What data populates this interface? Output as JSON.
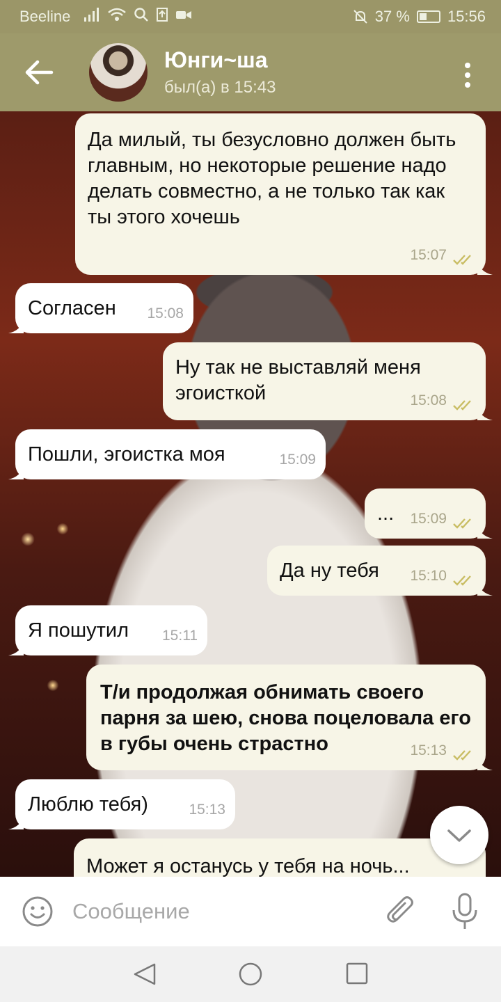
{
  "status_bar": {
    "carrier": "Beeline",
    "battery": "37 %",
    "battery_level": 0.37,
    "time": "15:56"
  },
  "header": {
    "title": "Юнги~ша",
    "status": "был(а) в 15:43"
  },
  "messages": [
    {
      "dir": "out",
      "text": "Да милый, ты безусловно должен быть главным, но некоторые решение надо делать совместно, а не только так как ты этого хочешь",
      "time": "15:07",
      "read": true
    },
    {
      "dir": "in",
      "text": "Согласен",
      "time": "15:08"
    },
    {
      "dir": "out",
      "text": "Ну так не выставляй меня эгоисткой",
      "time": "15:08",
      "read": true
    },
    {
      "dir": "in",
      "text": "Пошли, эгоистка моя",
      "time": "15:09"
    },
    {
      "dir": "out",
      "text": "...",
      "time": "15:09",
      "read": true
    },
    {
      "dir": "out",
      "text": "Да ну тебя",
      "time": "15:10",
      "read": true
    },
    {
      "dir": "in",
      "text": "Я пошутил",
      "time": "15:11"
    },
    {
      "dir": "out",
      "text": "Т/и продолжая обнимать своего парня за шею, снова поцеловала его в губы очень страстно",
      "time": "15:13",
      "read": true,
      "bold": true
    },
    {
      "dir": "in",
      "text": "Люблю тебя)",
      "time": "15:13"
    },
    {
      "dir": "out",
      "text": "Может я останусь у тебя на ночь...",
      "time": ""
    }
  ],
  "input": {
    "placeholder": "Сообщение"
  },
  "colors": {
    "header": "#9e9a6b",
    "outgoing_bubble": "#f7f5e7",
    "incoming_bubble": "#ffffff",
    "read_ticks": "#c9bd63"
  },
  "icons": [
    "back-arrow-icon",
    "more-vert-icon",
    "emoji-icon",
    "attach-icon",
    "mic-icon",
    "chevron-down-icon",
    "nav-back-icon",
    "nav-home-icon",
    "nav-recent-icon"
  ]
}
